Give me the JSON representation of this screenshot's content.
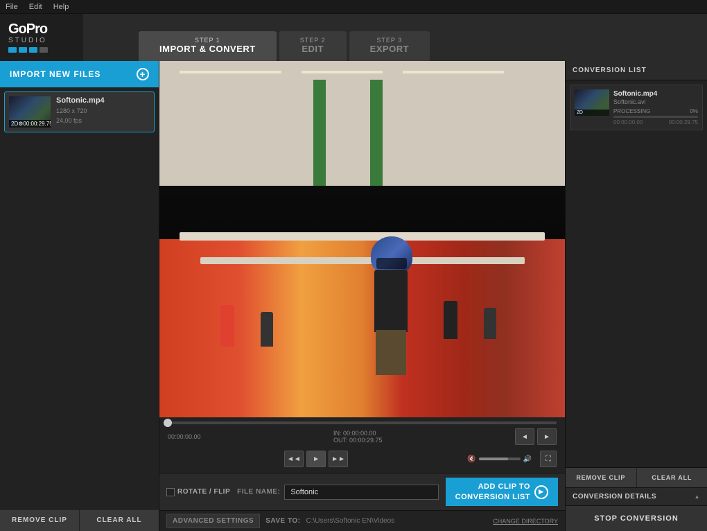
{
  "menubar": {
    "items": [
      "File",
      "Edit",
      "Help"
    ]
  },
  "logo": {
    "gopro": "GoPro",
    "studio": "STUDIO",
    "dots": [
      "#1a9fd4",
      "#1a9fd4",
      "#1a9fd4",
      "#555"
    ]
  },
  "steps": [
    {
      "id": "import",
      "num": "STEP 1",
      "name": "IMPORT & CONVERT",
      "active": true
    },
    {
      "id": "edit",
      "num": "STEP 2",
      "name": "EDIT",
      "active": false
    },
    {
      "id": "export",
      "num": "STEP 3",
      "name": "EXPORT",
      "active": false
    }
  ],
  "left_panel": {
    "import_btn": "IMPORT NEW FILES",
    "files": [
      {
        "name": "Softonic.mp4",
        "resolution": "1280 x 720",
        "fps": "24,00 fps",
        "badge": "2D",
        "duration": "00:00:29.75",
        "selected": true
      }
    ],
    "remove_btn": "REMOVE CLIP",
    "clear_btn": "CLEAR ALL"
  },
  "video": {
    "timestamp": "00:00:00.00",
    "in_point": "IN: 00:00:00.00",
    "out_point": "OUT: 00:00:29.75"
  },
  "transport": {
    "rewind": "◄◄",
    "play": "►",
    "forward": "►►"
  },
  "bottom_controls": {
    "rotate_label": "ROTATE / FLIP",
    "filename_label": "FILE NAME:",
    "filename_value": "Softonic",
    "add_btn_line1": "ADD CLIP TO",
    "add_btn_line2": "CONVERSION LIST",
    "saveto_label": "SAVE TO:",
    "saveto_path": "C:\\Users\\Softonic EN\\Videos",
    "change_dir": "CHANGE DIRECTORY",
    "adv_settings": "ADVANCED SETTINGS"
  },
  "right_panel": {
    "header": "CONVERSION LIST",
    "items": [
      {
        "name1": "Softonic.mp4",
        "name2": "Softonic.avi",
        "status": "PROCESSING",
        "percent": "0%",
        "progress": 0,
        "time1": "00:00:00.00",
        "time2": "00:00:29.75",
        "badge": "2D"
      }
    ],
    "remove_btn": "REMOVE CLIP",
    "clear_btn": "CLEAR ALL",
    "details_label": "CONVERSION DETAILS",
    "stop_btn": "STOP CONVERSION"
  }
}
